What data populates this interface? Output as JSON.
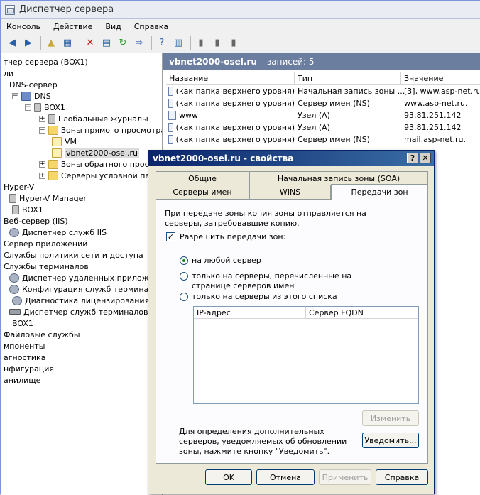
{
  "window": {
    "title": "Диспетчер сервера"
  },
  "menu": [
    "Консоль",
    "Действие",
    "Вид",
    "Справка"
  ],
  "toolbar_icons": [
    "back-arrow-icon",
    "forward-arrow-icon",
    "up-folder-icon",
    "show-hide-tree-icon",
    "delete-icon",
    "properties-icon",
    "refresh-icon",
    "export-list-icon",
    "help-icon",
    "show-action-pane-icon",
    "server-list-icon",
    "server-detail-icon",
    "server-status-icon"
  ],
  "tree": [
    {
      "label": "тчер сервера (BOX1)",
      "indent": 0,
      "icon": "none",
      "exp": ""
    },
    {
      "label": "ли",
      "indent": 0,
      "icon": "none",
      "exp": ""
    },
    {
      "label": "DNS-сервер",
      "indent": 1,
      "icon": "none",
      "exp": ""
    },
    {
      "label": "DNS",
      "indent": 2,
      "icon": "dns",
      "exp": "-"
    },
    {
      "label": "BOX1",
      "indent": 3,
      "icon": "server",
      "exp": "-"
    },
    {
      "label": "Глобальные журналы",
      "indent": 4,
      "icon": "server",
      "exp": "+"
    },
    {
      "label": "Зоны прямого просмотра",
      "indent": 4,
      "icon": "folder",
      "exp": "-"
    },
    {
      "label": "VM",
      "indent": 5,
      "icon": "zone",
      "exp": ""
    },
    {
      "label": "vbnet2000-osel.ru",
      "indent": 5,
      "icon": "zone",
      "exp": "",
      "selected": true
    },
    {
      "label": "Зоны обратного просмотра",
      "indent": 4,
      "icon": "folder",
      "exp": "+"
    },
    {
      "label": "Серверы условной пересыл",
      "indent": 4,
      "icon": "folder",
      "exp": "+"
    },
    {
      "label": "Hyper-V",
      "indent": 0,
      "icon": "none",
      "exp": ""
    },
    {
      "label": "Hyper-V Manager",
      "indent": 1,
      "icon": "server",
      "exp": ""
    },
    {
      "label": "BOX1",
      "indent": 2,
      "icon": "server",
      "exp": ""
    },
    {
      "label": "Веб-сервер (IIS)",
      "indent": 0,
      "icon": "none",
      "exp": ""
    },
    {
      "label": "Диспетчер служб IIS",
      "indent": 1,
      "icon": "gear",
      "exp": ""
    },
    {
      "label": "Сервер приложений",
      "indent": 0,
      "icon": "none",
      "exp": ""
    },
    {
      "label": "Службы политики сети и доступа",
      "indent": 0,
      "icon": "none",
      "exp": ""
    },
    {
      "label": "Службы терминалов",
      "indent": 0,
      "icon": "none",
      "exp": ""
    },
    {
      "label": "Диспетчер удаленных приложени",
      "indent": 1,
      "icon": "gear",
      "exp": ""
    },
    {
      "label": "Конфигурация служб терминалов:",
      "indent": 1,
      "icon": "gear",
      "exp": ""
    },
    {
      "label": "Диагностика лицензирования",
      "indent": 2,
      "icon": "gear",
      "exp": ""
    },
    {
      "label": "Диспетчер служб терминалов",
      "indent": 1,
      "icon": "disk",
      "exp": ""
    },
    {
      "label": "BOX1",
      "indent": 2,
      "icon": "none",
      "exp": ""
    },
    {
      "label": "Файловые службы",
      "indent": 0,
      "icon": "none",
      "exp": ""
    },
    {
      "label": "мпоненты",
      "indent": 0,
      "icon": "none",
      "exp": ""
    },
    {
      "label": "агностика",
      "indent": 0,
      "icon": "none",
      "exp": ""
    },
    {
      "label": "нфигурация",
      "indent": 0,
      "icon": "none",
      "exp": ""
    },
    {
      "label": "анилище",
      "indent": 0,
      "icon": "none",
      "exp": ""
    }
  ],
  "right": {
    "zone": "vbnet2000-osel.ru",
    "count": "записей: 5",
    "columns": [
      "Название",
      "Тип",
      "Значение"
    ],
    "rows": [
      [
        "(как папка верхнего уровня)",
        "Начальная запись зоны ...",
        "[3], www.asp-net.ru,"
      ],
      [
        "(как папка верхнего уровня)",
        "Сервер имен (NS)",
        "www.asp-net.ru."
      ],
      [
        "www",
        "Узел (A)",
        "93.81.251.142"
      ],
      [
        "(как папка верхнего уровня)",
        "Узел (A)",
        "93.81.251.142"
      ],
      [
        "(как папка верхнего уровня)",
        "Сервер имен (NS)",
        "mail.asp-net.ru."
      ]
    ]
  },
  "dialog": {
    "title": "vbnet2000-osel.ru - свойства",
    "help_btn": "?",
    "close_btn": "✕",
    "tabs_row1": [
      "Общие",
      "Начальная запись зоны (SOA)"
    ],
    "tabs_row2": [
      "Серверы имен",
      "WINS",
      "Передачи зон"
    ],
    "intro": "При передаче зоны копия зоны отправляется на серверы, затребовавшие копию.",
    "allow_label": "Разрешить передачи зон:",
    "allow_checked": true,
    "radio": [
      {
        "label": "на любой сервер",
        "checked": true
      },
      {
        "label": "только на серверы, перечисленные на странице серверов имен",
        "checked": false
      },
      {
        "label": "только на серверы из этого списка",
        "checked": false
      }
    ],
    "grid_cols": [
      "IP-адрес",
      "Сервер FQDN"
    ],
    "edit_btn": "Изменить",
    "notify_text": "Для определения дополнительных серверов, уведомляемых об обновлении зоны, нажмите кнопку \"Уведомить\".",
    "notify_btn": "Уведомить...",
    "ok": "OK",
    "cancel": "Отмена",
    "apply": "Применить",
    "help": "Справка"
  }
}
